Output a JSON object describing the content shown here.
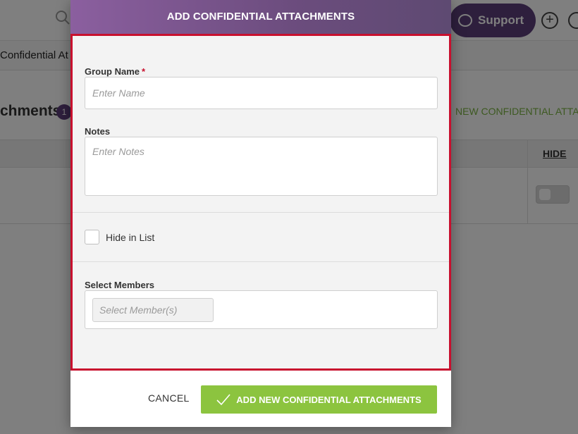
{
  "background": {
    "support_label": "Support",
    "tab_label": "Confidential At",
    "heading": "chments",
    "count_badge": "1",
    "new_link": "NEW CONFIDENTIAL ATTA",
    "hide_header": "HIDE"
  },
  "modal": {
    "title": "ADD CONFIDENTIAL ATTACHMENTS",
    "group_name": {
      "label": "Group Name",
      "required_marker": "*",
      "value": "",
      "placeholder": "Enter Name"
    },
    "notes": {
      "label": "Notes",
      "value": "",
      "placeholder": "Enter Notes"
    },
    "hide_in_list": {
      "label": "Hide in List",
      "checked": false
    },
    "select_members": {
      "label": "Select Members",
      "placeholder": "Select Member(s)"
    },
    "cancel_label": "CANCEL",
    "submit_label": "ADD NEW CONFIDENTIAL ATTACHMENTS"
  },
  "colors": {
    "header_gradient_start": "#8b5f9f",
    "header_gradient_end": "#5e4a72",
    "highlight_border": "#c8102e",
    "submit_green": "#8cc43f",
    "brand_purple": "#5d3f7a"
  }
}
